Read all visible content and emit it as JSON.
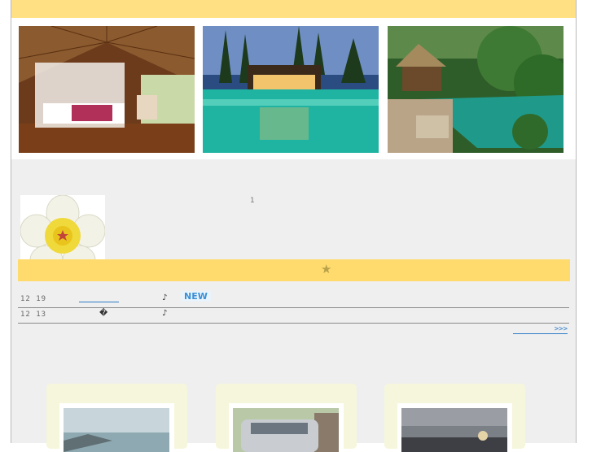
{
  "hero": {
    "images": [
      {
        "name": "villa-bedroom"
      },
      {
        "name": "resort-pool-night"
      },
      {
        "name": "jungle-pool"
      }
    ]
  },
  "intro": {
    "number": "1"
  },
  "news": {
    "items": [
      {
        "date": "12 19",
        "note": "♪",
        "badge": "NEW"
      },
      {
        "date": "12 13",
        "glyph": "�",
        "note": "♪"
      }
    ],
    "more_label": ">>>"
  },
  "colors": {
    "top_bar": "#ffe083",
    "news_bar": "#ffdb6e",
    "link": "#2e7cc7",
    "card": "#f6f6dc"
  },
  "icons": {
    "bar_icon": "star-icon"
  }
}
